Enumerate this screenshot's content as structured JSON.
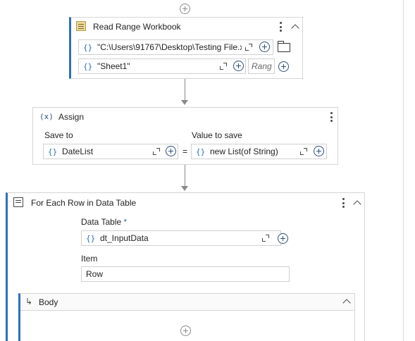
{
  "read_range": {
    "title": "Read Range Workbook",
    "workbook_path": "\"C:\\Users\\91767\\Desktop\\Testing File.x",
    "sheet_name": "\"Sheet1\"",
    "range_placeholder": "Rang"
  },
  "assign": {
    "title": "Assign",
    "save_to_label": "Save to",
    "value_label": "Value to save",
    "save_to_value": "DateList",
    "equals": "=",
    "value": "new List(of String)",
    "icon_text": "(x)"
  },
  "for_each": {
    "title": "For Each Row in Data Table",
    "data_table_label": "Data Table",
    "required_mark": "*",
    "data_table_value": "dt_InputData",
    "item_label": "Item",
    "item_value": "Row",
    "body_label": "Body",
    "body_icon": "↳"
  },
  "braces": "{}",
  "icons": {
    "add": "plus-circle-icon",
    "expand": "expand-icon",
    "more": "kebab-icon",
    "collapse": "chevron-up-icon",
    "folder": "folder-icon"
  },
  "colors": {
    "accent": "#2f6fbf",
    "border": "#d6d6d6",
    "connector": "#8a8a8a"
  }
}
